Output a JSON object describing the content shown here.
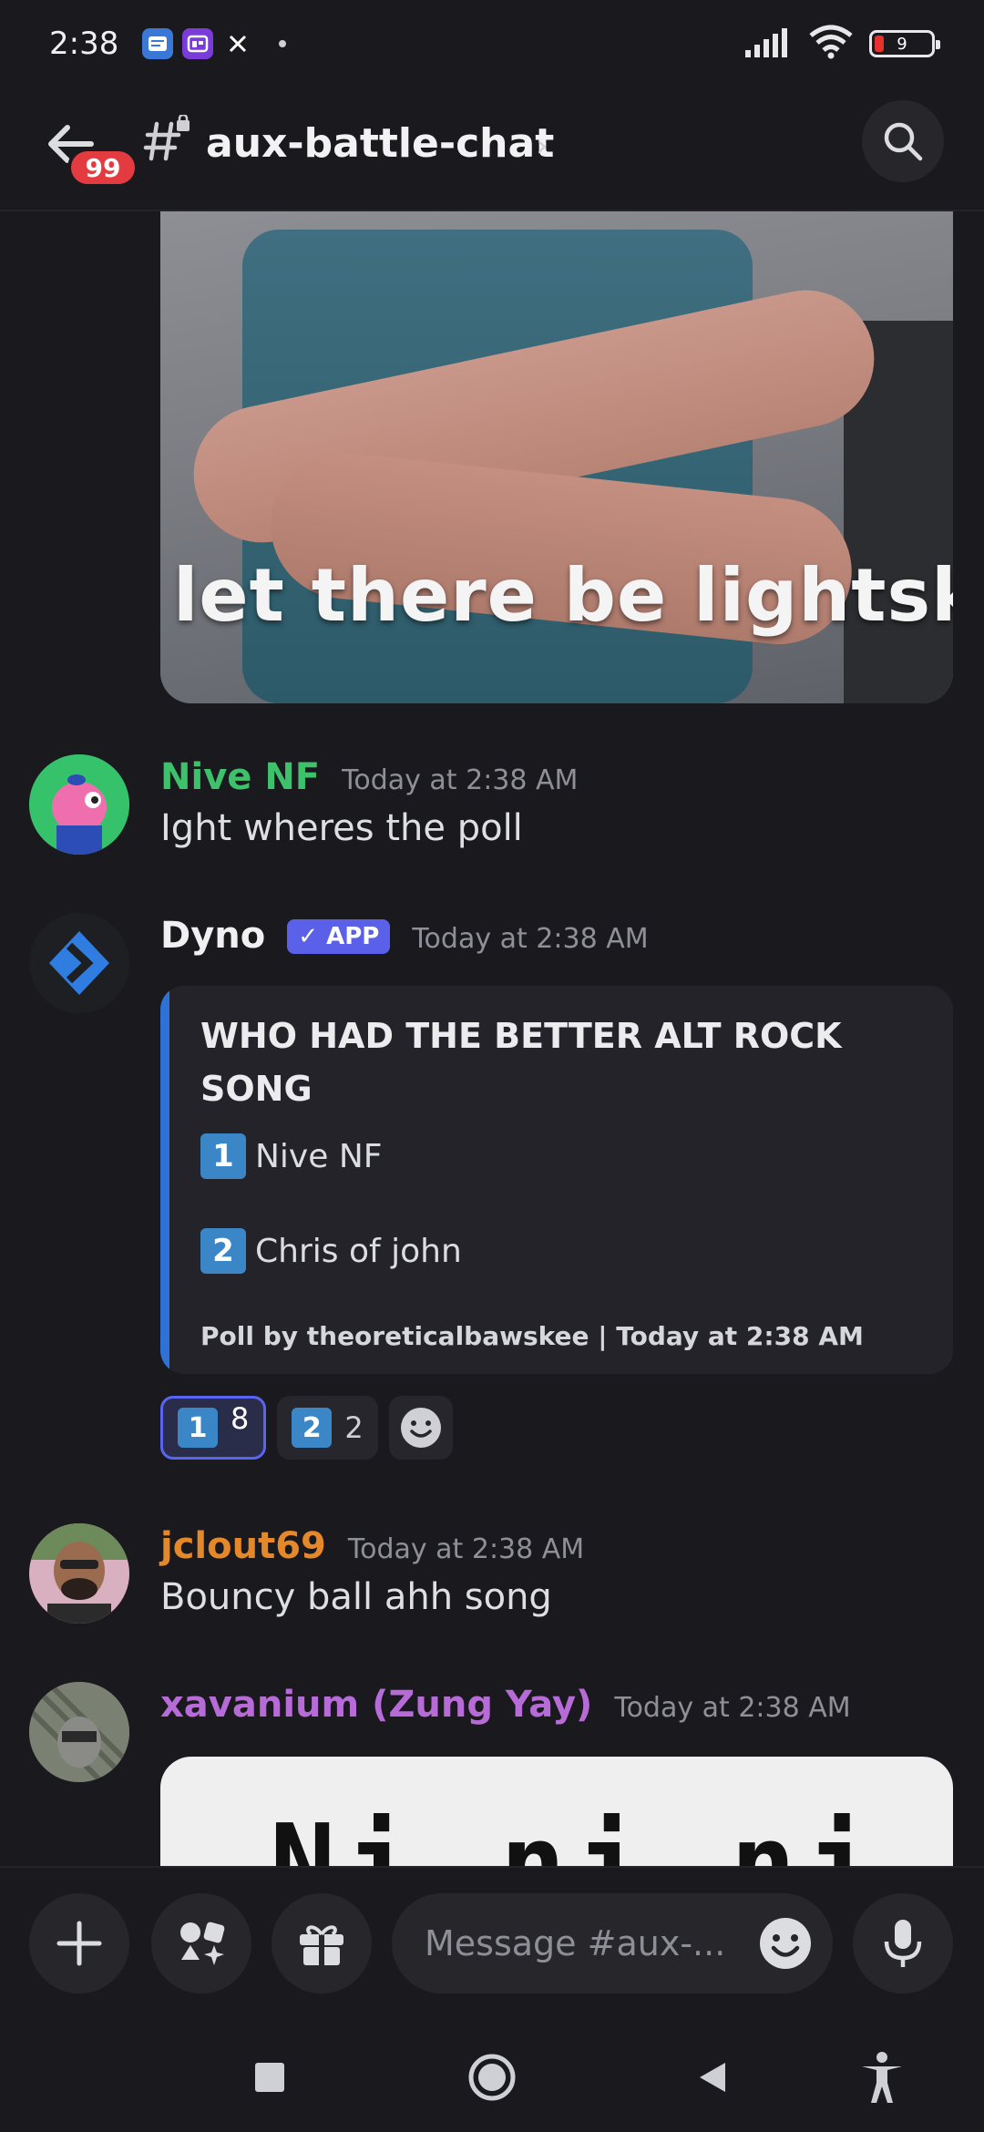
{
  "status_bar": {
    "time": "2:38",
    "battery": "9"
  },
  "header": {
    "badge_count": "99",
    "channel_name": "aux-battle-chat",
    "chevron": "›"
  },
  "gif": {
    "caption": "let there be lightskin"
  },
  "messages": [
    {
      "author": "Nive NF",
      "author_color": "#3ec16b",
      "timestamp": "Today at 2:38 AM",
      "text": "Ight wheres the poll"
    },
    {
      "author": "Dyno",
      "author_color": "#f0f0f2",
      "tag": "✓ APP",
      "timestamp": "Today at 2:38 AM",
      "embed": {
        "title": "WHO HAD THE BETTER ALT ROCK SONG",
        "options": [
          {
            "key": "1",
            "label": "Nive NF"
          },
          {
            "key": "2",
            "label": "Chris of john"
          }
        ],
        "footer": "Poll by theoreticalbawskee | Today at 2:38 AM"
      },
      "reactions": [
        {
          "key": "1",
          "count": "8",
          "active": true
        },
        {
          "key": "2",
          "count": "2",
          "active": false
        }
      ]
    },
    {
      "author": "jclout69",
      "author_color": "#e5882a",
      "timestamp": "Today at 2:38 AM",
      "text": "Bouncy ball ahh song"
    },
    {
      "author": "xavanium (Zung Yay)",
      "author_color": "#b66bd6",
      "timestamp": "Today at 2:38 AM",
      "image_text": "Ni ni ni"
    }
  ],
  "composer": {
    "placeholder": "Message #aux-..."
  },
  "icons": {
    "back": "arrow-left-icon",
    "channel": "hashtag-lock-icon",
    "search": "search-icon",
    "plus": "plus-icon",
    "apps": "apps-icon",
    "gift": "gift-icon",
    "emoji": "emoji-icon",
    "mic": "microphone-icon"
  }
}
